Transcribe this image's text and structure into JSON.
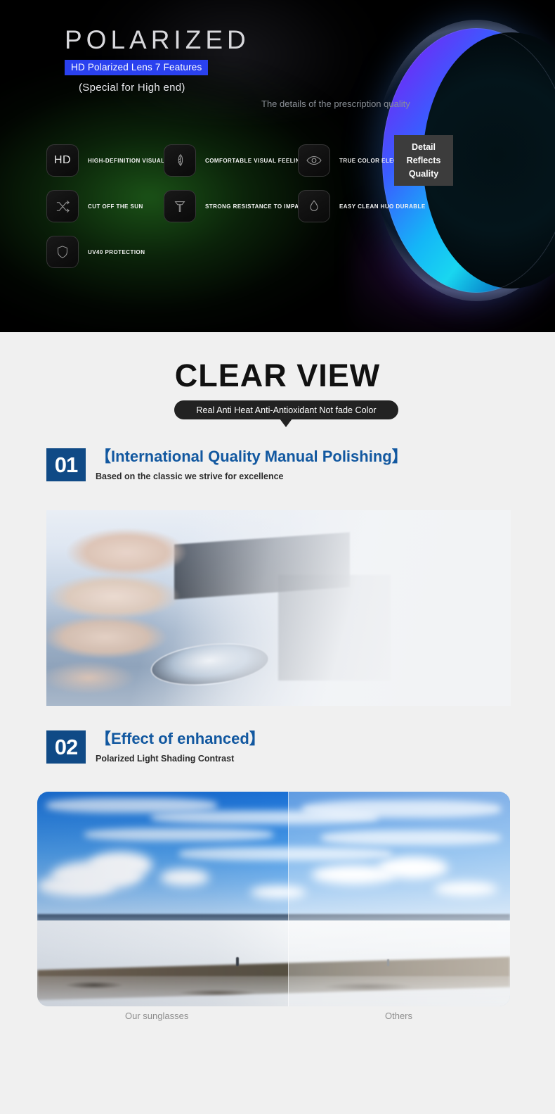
{
  "hero": {
    "title": "POLARIZED",
    "badge": "HD Polarized Lens 7 Features",
    "subtitle": "(Special for High end)",
    "badge_color": "#2a41ef",
    "features": [
      {
        "icon": "hd-icon",
        "icon_text": "HD",
        "label": "HIGH-DEFINITION VISUAL"
      },
      {
        "icon": "leaf-icon",
        "icon_text": "",
        "label": "COMFORTABLE VISUAL FEELING"
      },
      {
        "icon": "eye-icon",
        "icon_text": "",
        "label": "TRUE COLOR ELECTRIC"
      },
      {
        "icon": "shuffle-icon",
        "icon_text": "",
        "label": "CUT OFF THE SUN"
      },
      {
        "icon": "hammer-icon",
        "icon_text": "",
        "label": "STRONG RESISTANCE TO IMPACT"
      },
      {
        "icon": "droplet-icon",
        "icon_text": "",
        "label": "EASY CLEAN HUO DURABLE"
      },
      {
        "icon": "shield-icon",
        "icon_text": "",
        "label": "UV40 PROTECTION"
      }
    ]
  },
  "clear_view": {
    "title": "CLEAR VIEW",
    "banner": "Real Anti Heat Anti-Antioxidant Not fade Color"
  },
  "sections": [
    {
      "number": "01",
      "title": "【International Quality Manual Polishing】",
      "subtitle": "Based on the classic we strive for excellence",
      "accent_color": "#104a86",
      "title_color": "#1258a0",
      "photo_caption": "The details of the prescription quality",
      "tag_lines": [
        "Detail",
        "Reflects",
        "Quality"
      ]
    },
    {
      "number": "02",
      "title": "【Effect of enhanced】",
      "subtitle": "Polarized Light Shading Contrast",
      "accent_color": "#104a86",
      "title_color": "#1258a0",
      "compare_labels": {
        "left": "Our sunglasses",
        "right": "Others"
      }
    }
  ]
}
